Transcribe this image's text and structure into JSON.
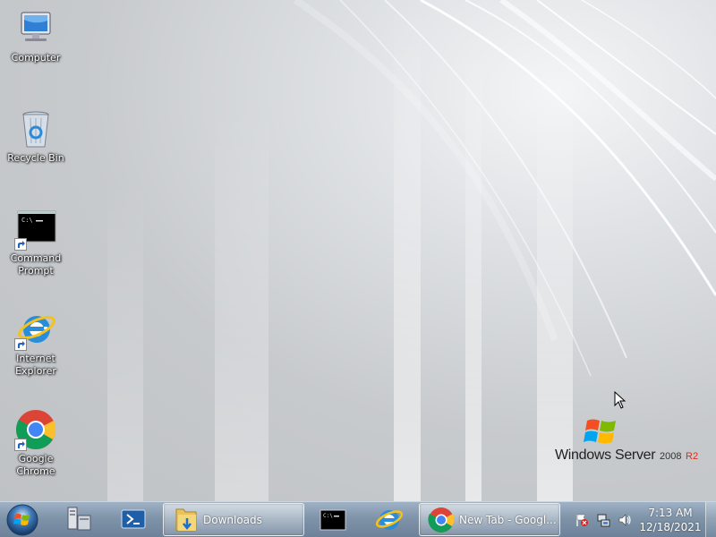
{
  "desktop": {
    "icons": [
      {
        "label": "Computer",
        "icon": "computer-icon",
        "shortcut": false
      },
      {
        "label": "Recycle Bin",
        "icon": "recycle-bin-icon",
        "shortcut": false
      },
      {
        "label": "Command Prompt",
        "icon": "command-prompt-icon",
        "shortcut": true
      },
      {
        "label": "Internet Explorer",
        "icon": "internet-explorer-icon",
        "shortcut": true
      },
      {
        "label": "Google Chrome",
        "icon": "google-chrome-icon",
        "shortcut": true
      }
    ],
    "logo": {
      "brand": "Windows Server",
      "version": "2008",
      "edition": "R2"
    }
  },
  "taskbar": {
    "start_icon": "windows-start-icon",
    "items": [
      {
        "icon": "server-manager-icon",
        "label": ""
      },
      {
        "icon": "powershell-icon",
        "label": ""
      },
      {
        "icon": "folder-icon",
        "label": "Downloads",
        "active": true
      },
      {
        "icon": "command-prompt-icon",
        "label": ""
      },
      {
        "icon": "internet-explorer-icon",
        "label": ""
      },
      {
        "icon": "google-chrome-icon",
        "label": "New Tab - Googl...",
        "active": true
      }
    ],
    "tray": {
      "icons": [
        "action-center-flag-icon",
        "network-icon",
        "volume-icon"
      ],
      "time": "7:13 AM",
      "date": "12/18/2021"
    }
  },
  "colors": {
    "taskbar": "#7f93a9",
    "logo_r2": "#d4301c"
  }
}
